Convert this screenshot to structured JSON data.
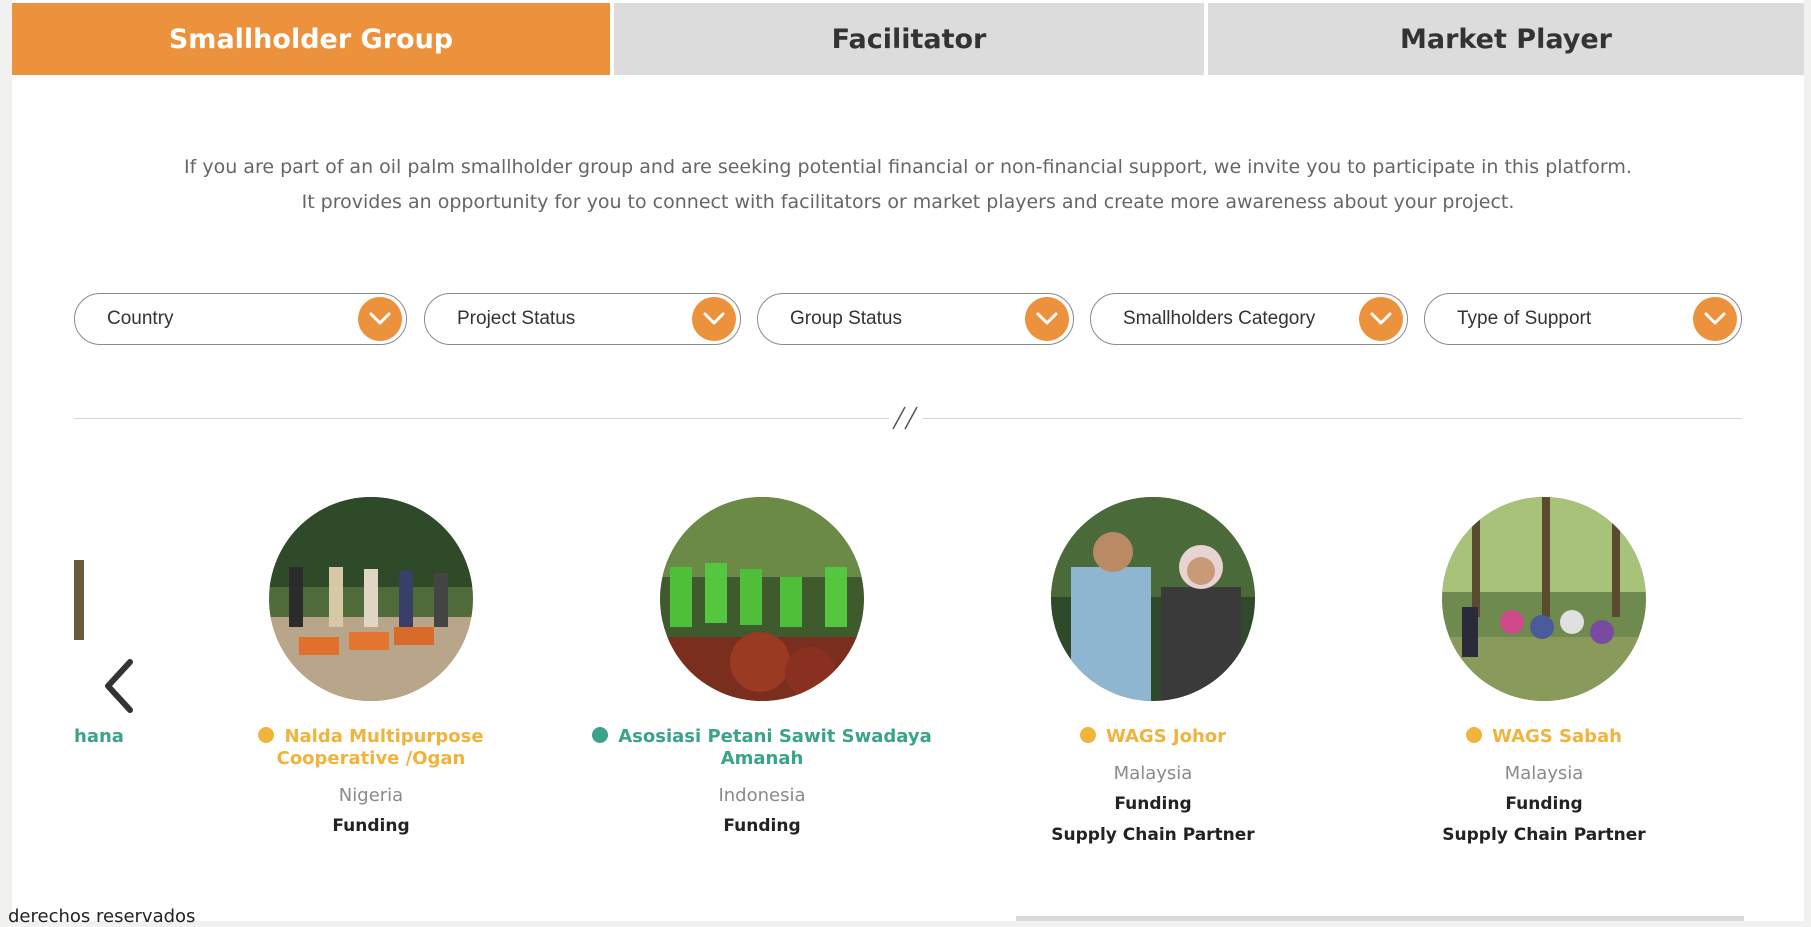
{
  "tabs": [
    {
      "label": "Smallholder Group",
      "active": true
    },
    {
      "label": "Facilitator",
      "active": false
    },
    {
      "label": "Market Player",
      "active": false
    }
  ],
  "intro": {
    "line1": "If you are part of an oil palm smallholder group and are seeking potential financial or non-financial support, we invite you to participate in this platform.",
    "line2": "It provides an opportunity for you to connect with facilitators or market players and create more awareness about your project."
  },
  "filters": [
    {
      "label": "Country",
      "icon": "chevron-down-icon"
    },
    {
      "label": "Project Status",
      "icon": "chevron-down-icon"
    },
    {
      "label": "Group Status",
      "icon": "chevron-down-icon"
    },
    {
      "label": "Smallholders Category",
      "icon": "chevron-down-icon"
    },
    {
      "label": "Type of Support",
      "icon": "chevron-down-icon"
    }
  ],
  "colors": {
    "accent": "#ec913c",
    "status_yellow": "#f0b43c",
    "status_green": "#3aa38a"
  },
  "carousel": {
    "partial_label": "hana",
    "prev_icon": "chevron-left-icon",
    "cards": [
      {
        "name_line1": "Nalda Multipurpose",
        "name_line2": "Cooperative /Ogan",
        "country": "Nigeria",
        "support": [
          "Funding"
        ],
        "status": "yellow"
      },
      {
        "name_line1": "Asosiasi Petani Sawit Swadaya",
        "name_line2": "Amanah",
        "country": "Indonesia",
        "support": [
          "Funding"
        ],
        "status": "green"
      },
      {
        "name_line1": "WAGS Johor",
        "name_line2": "",
        "country": "Malaysia",
        "support": [
          "Funding",
          "Supply Chain Partner"
        ],
        "status": "yellow"
      },
      {
        "name_line1": "WAGS Sabah",
        "name_line2": "",
        "country": "Malaysia",
        "support": [
          "Funding",
          "Supply Chain Partner"
        ],
        "status": "yellow"
      }
    ]
  },
  "footer": {
    "text": "derechos reservados"
  }
}
